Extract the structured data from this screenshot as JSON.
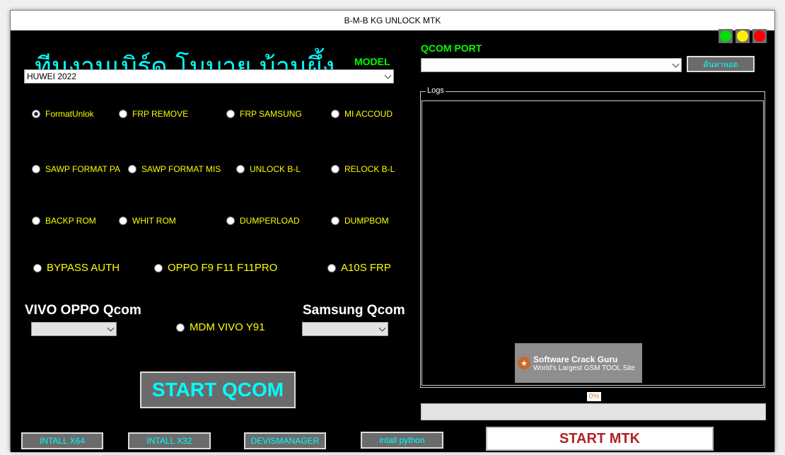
{
  "window": {
    "title": "B-M-B KG UNLOCK MTK"
  },
  "header": {
    "thai_title": "ทีมงานเบิร์ด โมบาย บ้านผึ้ง",
    "model_label": "MODEL"
  },
  "model_select": {
    "value": "HUWEI 2022"
  },
  "options": {
    "row1": [
      "FormatUnlok",
      "FRP REMOVE",
      "FRP SAMSUNG",
      "MI ACCOUD"
    ],
    "row2": [
      "SAWP FORMAT PA",
      "SAWP FORMAT MIS",
      "UNLOCK B-L",
      "RELOCK B-L"
    ],
    "row3": [
      "BACKP ROM",
      "WHIT ROM",
      "DUMPERLOAD",
      "DUMPBOM"
    ],
    "row4": [
      "BYPASS AUTH",
      "OPPO F9 F11 F11PRO",
      "A10S FRP"
    ],
    "mdm": "MDM VIVO Y91",
    "selected": "FormatUnlok"
  },
  "groups": {
    "vivo_oppo": "VIVO OPPO Qcom",
    "samsung": "Samsung Qcom"
  },
  "buttons": {
    "start_qcom": "START QCOM",
    "start_mtk": "START MTK",
    "install_x64": "INTALL X64",
    "install_x32": "INTALL X32",
    "device_manager": "DEVISMANAGER",
    "install_python": "intall python",
    "find_port": "ค้นหาพอต"
  },
  "qcom": {
    "label": "QCOM PORT",
    "value": ""
  },
  "logs": {
    "label": "Logs"
  },
  "progress": {
    "percent_text": "0%",
    "value": 0
  },
  "watermark": {
    "title": "Software Crack Guru",
    "subtitle": "World's Largest GSM TOOL Site"
  },
  "lights": {
    "green": "#00e000",
    "yellow": "#ffee00",
    "red": "#ff0000"
  }
}
